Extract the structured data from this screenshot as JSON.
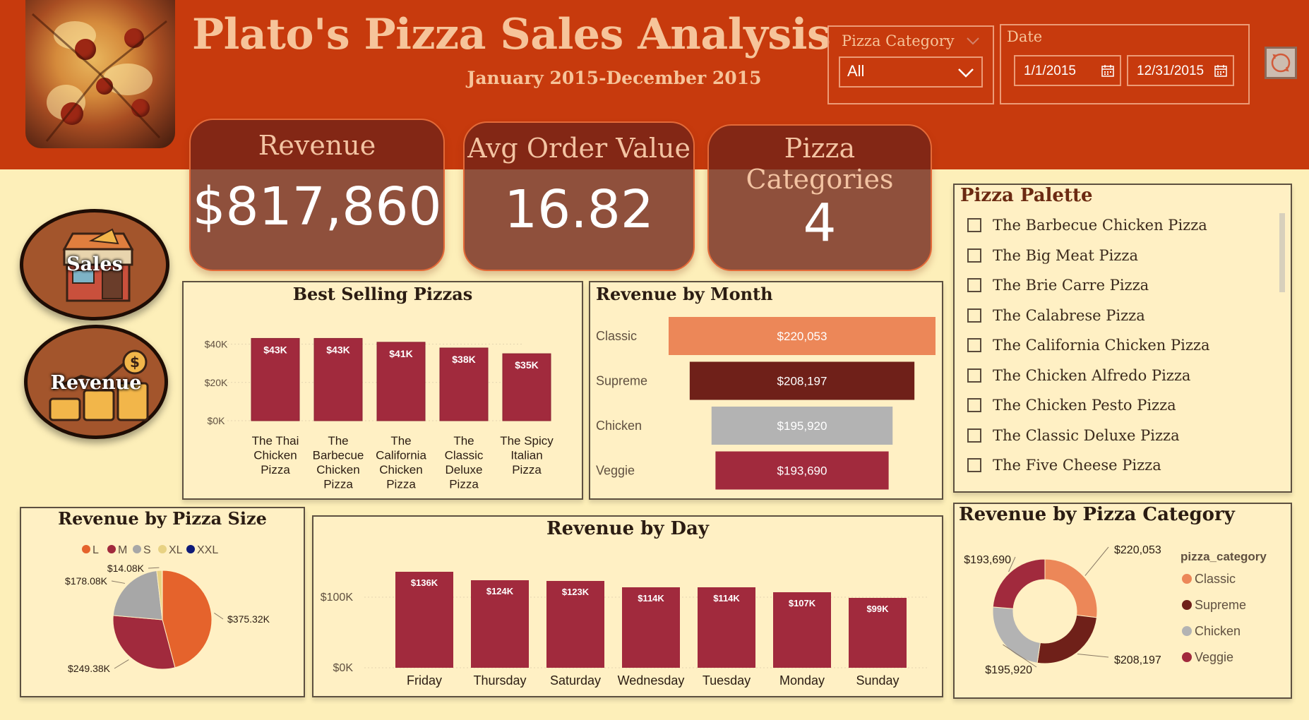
{
  "header": {
    "title": "Plato's Pizza Sales Analysis",
    "subtitle": "January 2015-December 2015"
  },
  "filters": {
    "category_title": "Pizza Category",
    "category_value": "All",
    "date_title": "Date",
    "date_start": "1/1/2015",
    "date_end": "12/31/2015"
  },
  "kpis": [
    {
      "label": "Revenue",
      "value": "$817,860"
    },
    {
      "label": "Avg Order Value",
      "value": "16.82"
    },
    {
      "label": "Pizza Categories",
      "value": "4"
    }
  ],
  "nav": {
    "sales": "Sales",
    "revenue": "Revenue"
  },
  "palette": {
    "title": "Pizza Palette",
    "items": [
      "The Barbecue Chicken Pizza",
      "The Big Meat Pizza",
      "The Brie Carre Pizza",
      "The Calabrese Pizza",
      "The California Chicken Pizza",
      "The Chicken Alfredo Pizza",
      "The Chicken Pesto Pizza",
      "The Classic Deluxe Pizza",
      "The Five Cheese Pizza"
    ]
  },
  "colors": {
    "bar": "#a12a3d",
    "classic": "#ec8758",
    "supreme": "#6f2019",
    "chicken": "#b3b3b3",
    "veggie": "#a12a3d",
    "size_L": "#e5632c",
    "size_M": "#a12a3d",
    "size_S": "#a7a7a7",
    "size_XL": "#e8d283",
    "size_XXL": "#0e1a78"
  },
  "chart_data": [
    {
      "id": "best_selling",
      "type": "bar",
      "title": "Best Selling Pizzas",
      "categories": [
        "The Thai Chicken Pizza",
        "The Barbecue Chicken Pizza",
        "The California Chicken Pizza",
        "The Classic Deluxe Pizza",
        "The Spicy Italian Pizza"
      ],
      "category_lines": [
        [
          "The Thai",
          "Chicken",
          "Pizza"
        ],
        [
          "The",
          "Barbecue",
          "Chicken",
          "Pizza"
        ],
        [
          "The",
          "California",
          "Chicken",
          "Pizza"
        ],
        [
          "The",
          "Classic",
          "Deluxe",
          "Pizza"
        ],
        [
          "The Spicy",
          "Italian",
          "Pizza"
        ]
      ],
      "values": [
        43000,
        43000,
        41000,
        38000,
        35000
      ],
      "data_labels": [
        "$43K",
        "$43K",
        "$41K",
        "$38K",
        "$35K"
      ],
      "yticks": [
        0,
        20000,
        40000
      ],
      "ytick_labels": [
        "$0K",
        "$20K",
        "$40K"
      ],
      "ylim": [
        0,
        45000
      ],
      "grid": true
    },
    {
      "id": "revenue_by_month",
      "type": "bar",
      "orientation": "horizontal-funnel",
      "title": "Revenue by Month",
      "categories": [
        "Classic",
        "Supreme",
        "Chicken",
        "Veggie"
      ],
      "values": [
        220053,
        208197,
        195920,
        193690
      ],
      "data_labels": [
        "$220,053",
        "$208,197",
        "$195,920",
        "$193,690"
      ],
      "colors": [
        "#ec8758",
        "#6f2019",
        "#b3b3b3",
        "#a12a3d"
      ]
    },
    {
      "id": "revenue_by_size",
      "type": "pie",
      "title": "Revenue by Pizza Size",
      "legend": [
        "L",
        "M",
        "S",
        "XL",
        "XXL"
      ],
      "legend_placement": "top",
      "values": [
        375320,
        249380,
        178080,
        14080,
        1010
      ],
      "data_labels": [
        "$375.32K",
        "$249.38K",
        "$178.08K",
        "$14.08K",
        ""
      ],
      "colors": [
        "#e5632c",
        "#a12a3d",
        "#a7a7a7",
        "#e8d283",
        "#0e1a78"
      ]
    },
    {
      "id": "revenue_by_day",
      "type": "bar",
      "title": "Revenue by Day",
      "categories": [
        "Friday",
        "Thursday",
        "Saturday",
        "Wednesday",
        "Tuesday",
        "Monday",
        "Sunday"
      ],
      "values": [
        136000,
        124000,
        123000,
        114000,
        114000,
        107000,
        99000
      ],
      "data_labels": [
        "$136K",
        "$124K",
        "$123K",
        "$114K",
        "$114K",
        "$107K",
        "$99K"
      ],
      "yticks": [
        0,
        100000
      ],
      "ytick_labels": [
        "$0K",
        "$100K"
      ],
      "ylim": [
        0,
        140000
      ],
      "grid": true
    },
    {
      "id": "revenue_by_category",
      "type": "pie",
      "subtype": "donut",
      "title": "Revenue by Pizza Category",
      "legend_title": "pizza_category",
      "legend": [
        "Classic",
        "Supreme",
        "Chicken",
        "Veggie"
      ],
      "legend_placement": "right",
      "values": [
        220053,
        208197,
        195920,
        193690
      ],
      "data_labels": [
        "$220,053",
        "$208,197",
        "$195,920",
        "$193,690"
      ],
      "colors": [
        "#ec8758",
        "#6f2019",
        "#b3b3b3",
        "#a12a3d"
      ]
    }
  ]
}
